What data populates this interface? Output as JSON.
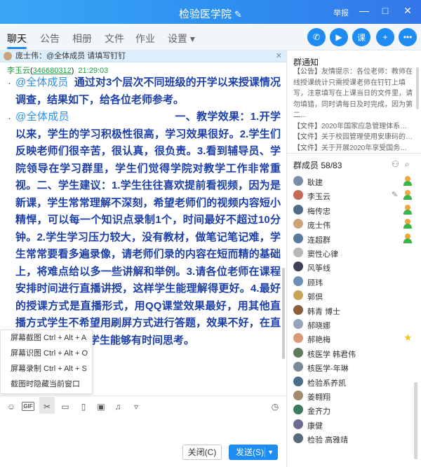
{
  "window": {
    "title": "检验医学院",
    "report_label": "举报",
    "minimize_glyph": "—",
    "maximize_glyph": "□",
    "close_glyph": "✕"
  },
  "tabs": [
    {
      "label": "聊天"
    },
    {
      "label": "公告"
    },
    {
      "label": "相册"
    },
    {
      "label": "文件"
    },
    {
      "label": "作业"
    },
    {
      "label": "设置"
    }
  ],
  "settings_caret": "▾",
  "pinned": {
    "text": "庞士伟：@全体成员 请填写钉钉"
  },
  "message": {
    "sender_name": "李玉云",
    "sender_qq": "346680312",
    "time": "21:29:03",
    "para1_mention": "@全体成员",
    "para1_text": "通过对3个层次不同班级的开学以来授课情况调查，结果如下，给各位老师参考。",
    "para2_mention": "@全体成员",
    "para2_text": "一、教学效果：1.开学以来，学生的学习积极性很高，学习效果很好。2.学生们反映老师们很辛苦，很认真，很负责。3.看到辅导员、学院领导在学习群里，学生们觉得学院对教学工作非常重视。二、学生建议：1.学生往往喜欢提前看视频，因为是新课，学生常常理解不深刻，希望老师们的视频内容短小精悍，可以每一个知识点录制1个，时间最好不超过10分钟。2.学生学习压力较大，没有教材，做笔记笔记难，学生常常要看多遍录像，请老师们录的内容在短而精的基础上，将难点给以多一些讲解和举例。3.请各位老师在课程安排时间进行直播讲授，这样学生能理解得更好。4.最好的授课方式是直播形式，用QQ课堂效果最好，用其他直播方式学生不希望用刷屏方式进行答题，效果不好，在直播时沟通进行，学生能够有时间思考。"
  },
  "context_menu": {
    "items": [
      {
        "label": "屏幕截图 Ctrl + Alt + A"
      },
      {
        "label": "屏幕识图 Ctrl + Alt + O"
      },
      {
        "label": "屏幕录制 Ctrl + Alt + S"
      },
      {
        "label": "截图时隐藏当前窗口"
      }
    ]
  },
  "toolbar": {
    "gif_label": "GIF"
  },
  "buttons": {
    "close_label": "关闭(C)",
    "send_label": "发送(S)"
  },
  "notice": {
    "title": "群通知",
    "announcement_tag": "【公告】",
    "announcement_text": "友情提示：各位老师：教师在线授课统计只需授课老师在钉钉上填写，注意填写在上课当日的文件里，请勿填错，同时请每日及时完成，因为第二...",
    "files": [
      {
        "tag": "【文件】",
        "text": "2020年国家应急管理体系建设..."
      },
      {
        "tag": "【文件】",
        "text": "关于校园管理使用安康码的通..."
      },
      {
        "tag": "【文件】",
        "text": "关于开展2020年享受国务院和..."
      }
    ]
  },
  "members": {
    "title": "群成员",
    "count": "58/83",
    "list": [
      {
        "name": "耿建",
        "avatar_color": "#7a8fa6",
        "role": "admin-green"
      },
      {
        "name": "李玉云",
        "avatar_color": "#c56b53",
        "role": "admin-green",
        "editable": true
      },
      {
        "name": "梅传忠",
        "avatar_color": "#4f6a86",
        "role": "admin-green"
      },
      {
        "name": "庞士伟",
        "avatar_color": "#caa37a",
        "role": "admin-green"
      },
      {
        "name": "连超群",
        "avatar_color": "#5a7a9a",
        "role": "admin-green"
      },
      {
        "name": "窦性心律",
        "avatar_color": "#b8b8b8"
      },
      {
        "name": "风筝线",
        "avatar_color": "#3b3f58"
      },
      {
        "name": "顾玮",
        "avatar_color": "#6d8fb5"
      },
      {
        "name": "郭倶",
        "avatar_color": "#c9a35a"
      },
      {
        "name": "韩青 博士",
        "avatar_color": "#8b5e3c"
      },
      {
        "name": "郝晓娜",
        "avatar_color": "#94a3b8"
      },
      {
        "name": "郝艳梅",
        "avatar_color": "#d99a76",
        "star": true
      },
      {
        "name": "核医学 韩君伟",
        "avatar_color": "#5f7c5a"
      },
      {
        "name": "核医学-年琳",
        "avatar_color": "#7b8a99"
      },
      {
        "name": "检验系养凯",
        "avatar_color": "#4a6d8c"
      },
      {
        "name": "姜翱翔",
        "avatar_color": "#a58a6f"
      },
      {
        "name": "金齐力",
        "avatar_color": "#3f7a5e"
      },
      {
        "name": "康健",
        "avatar_color": "#6b6b8f"
      },
      {
        "name": "检验 高雅靖",
        "avatar_color": "#556b7a"
      }
    ]
  },
  "colors": {
    "accent": "#1e8cf0",
    "message_text": "#1d3fa8",
    "mention": "#2a8ff0",
    "sender": "#1a9d3e",
    "admin_badge_head": "#f0a73a",
    "admin_badge_body": "#39b54a",
    "star": "#f5c518"
  }
}
